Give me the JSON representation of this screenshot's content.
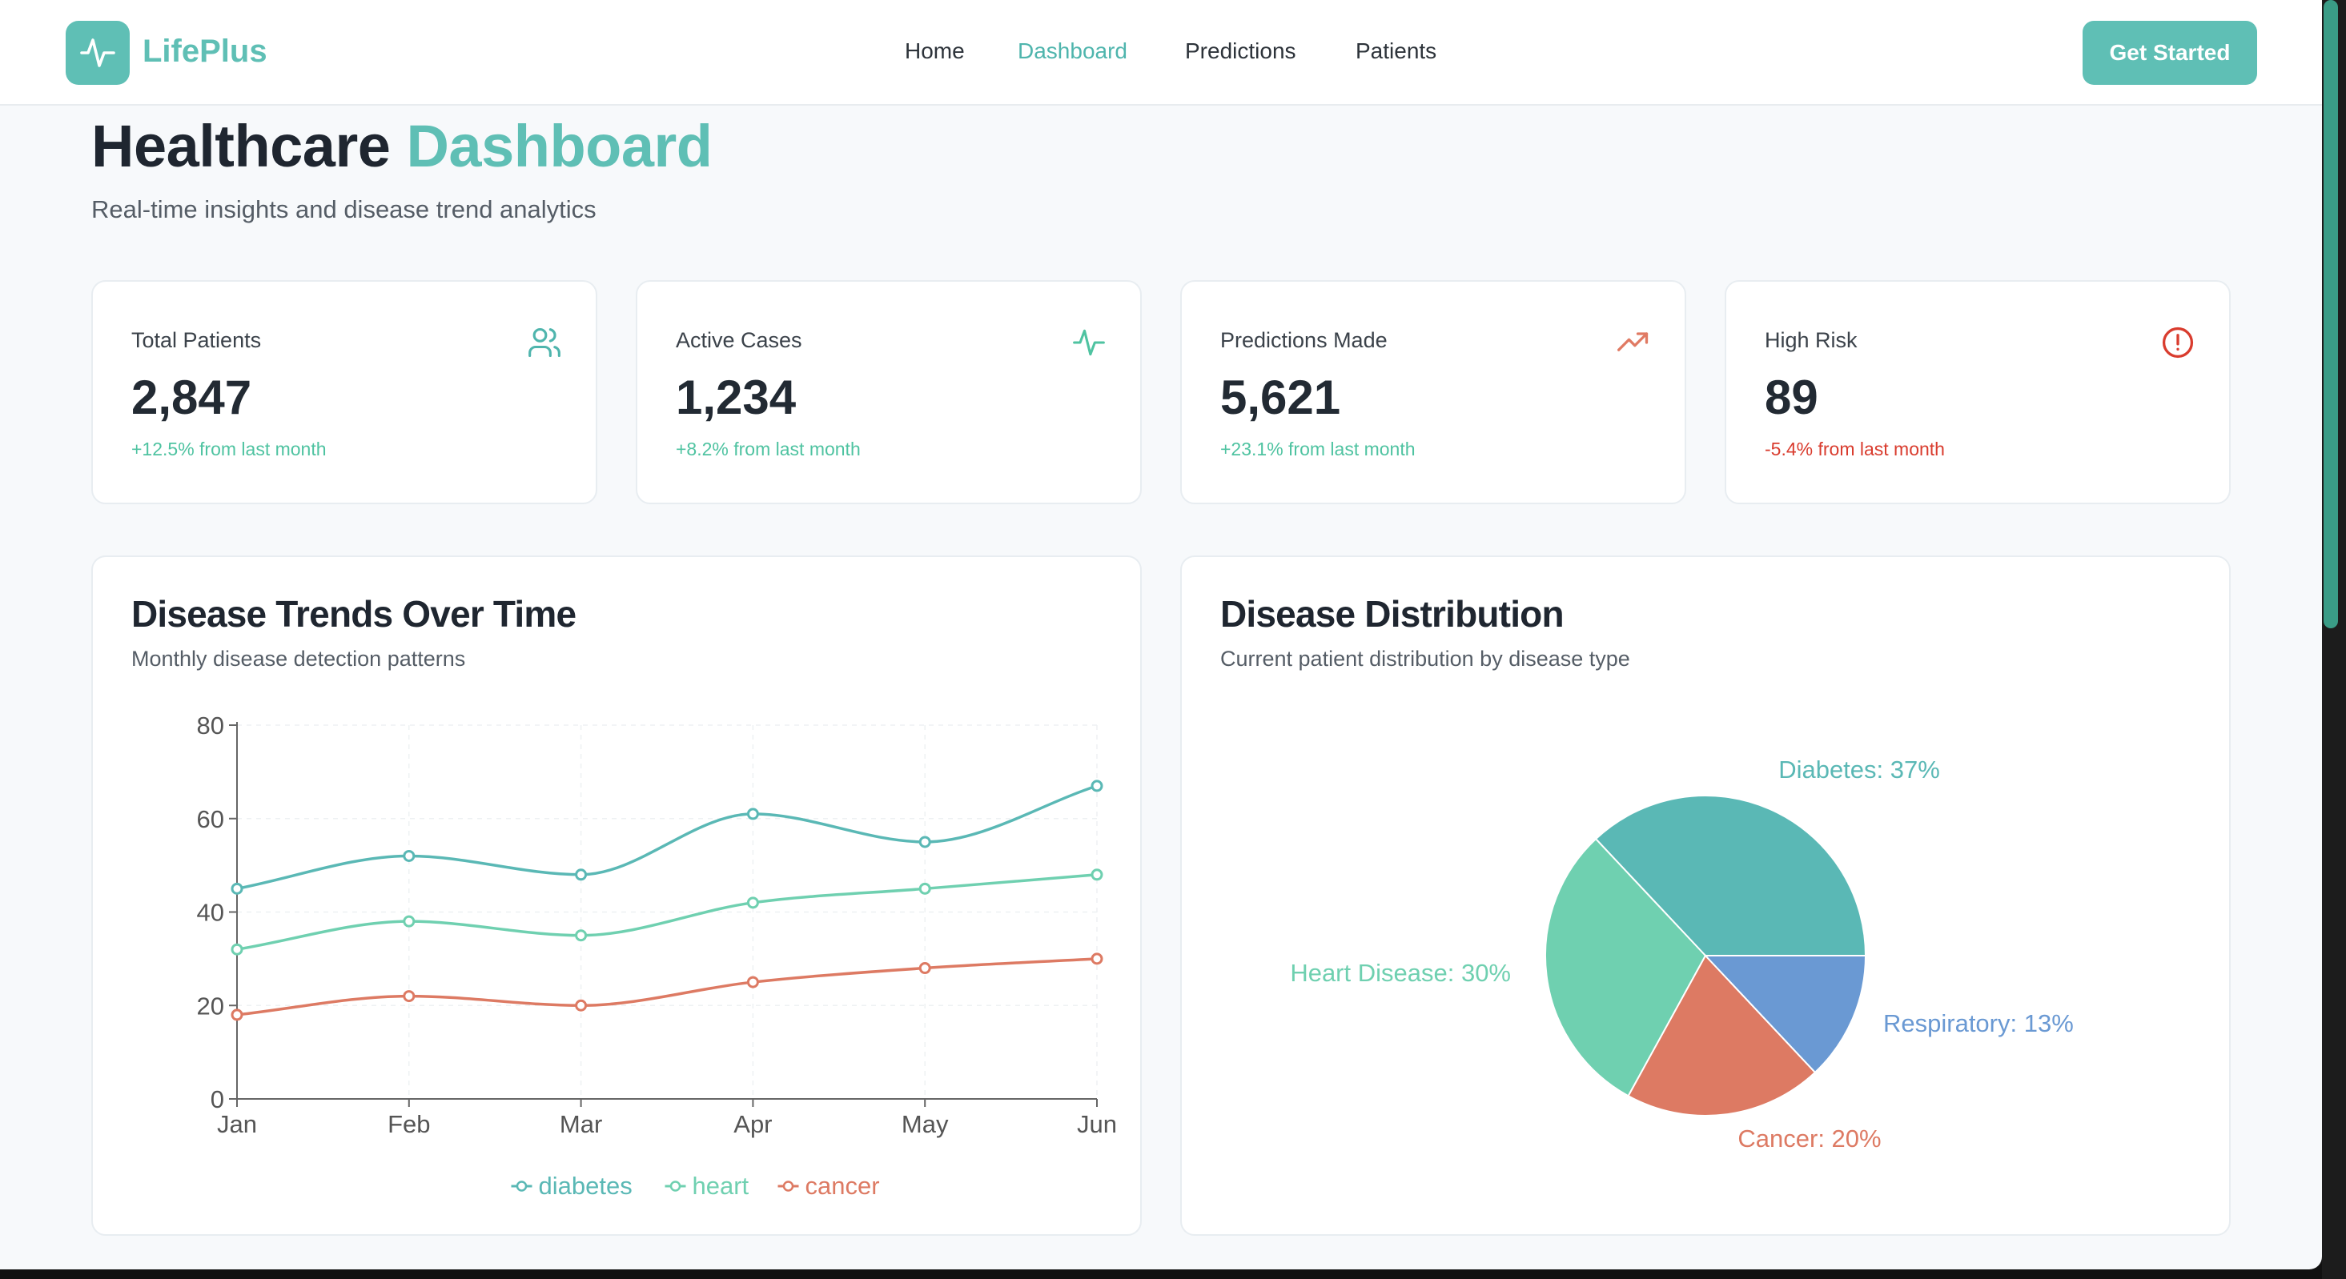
{
  "header": {
    "brand": "LifePlus",
    "nav": [
      {
        "label": "Home",
        "active": false
      },
      {
        "label": "Dashboard",
        "active": true
      },
      {
        "label": "Predictions",
        "active": false
      },
      {
        "label": "Patients",
        "active": false
      }
    ],
    "cta_label": "Get Started"
  },
  "page": {
    "title_main": "Healthcare",
    "title_accent": "Dashboard",
    "subtitle": "Real-time insights and disease trend analytics"
  },
  "stats": [
    {
      "label": "Total Patients",
      "value": "2,847",
      "change": "+12.5% from last month",
      "icon": "users-icon",
      "change_color": "#4fc3a1",
      "icon_color": "#4fb5ad"
    },
    {
      "label": "Active Cases",
      "value": "1,234",
      "change": "+8.2% from last month",
      "icon": "activity-icon",
      "change_color": "#4fc3a1",
      "icon_color": "#4fc3a1"
    },
    {
      "label": "Predictions Made",
      "value": "5,621",
      "change": "+23.1% from last month",
      "icon": "trending-up-icon",
      "change_color": "#4fc3a1",
      "icon_color": "#e07a63"
    },
    {
      "label": "High Risk",
      "value": "89",
      "change": "-5.4% from last month",
      "icon": "alert-circle-icon",
      "change_color": "#d93c2e",
      "icon_color": "#d93c2e"
    }
  ],
  "trends": {
    "title": "Disease Trends Over Time",
    "subtitle": "Monthly disease detection patterns"
  },
  "distribution": {
    "title": "Disease Distribution",
    "subtitle": "Current patient distribution by disease type"
  },
  "colors": {
    "accent": "#5fbfb5",
    "diabetes": "#5ab8b5",
    "heart": "#6fd0b0",
    "cancer": "#dd7a63",
    "respiratory": "#6a99d3"
  },
  "chart_data": [
    {
      "type": "line",
      "categories": [
        "Jan",
        "Feb",
        "Mar",
        "Apr",
        "May",
        "Jun"
      ],
      "ylim": [
        0,
        80
      ],
      "yticks": [
        0,
        20,
        40,
        60,
        80
      ],
      "series": [
        {
          "name": "diabetes",
          "values": [
            45,
            52,
            48,
            61,
            55,
            67
          ]
        },
        {
          "name": "heart",
          "values": [
            32,
            38,
            35,
            42,
            45,
            48
          ]
        },
        {
          "name": "cancer",
          "values": [
            18,
            22,
            20,
            25,
            28,
            30
          ]
        }
      ],
      "legend_position": "bottom-center"
    },
    {
      "type": "pie",
      "slices": [
        {
          "label": "Diabetes",
          "value": 37
        },
        {
          "label": "Heart Disease",
          "value": 30
        },
        {
          "label": "Cancer",
          "value": 20
        },
        {
          "label": "Respiratory",
          "value": 13
        }
      ]
    }
  ]
}
